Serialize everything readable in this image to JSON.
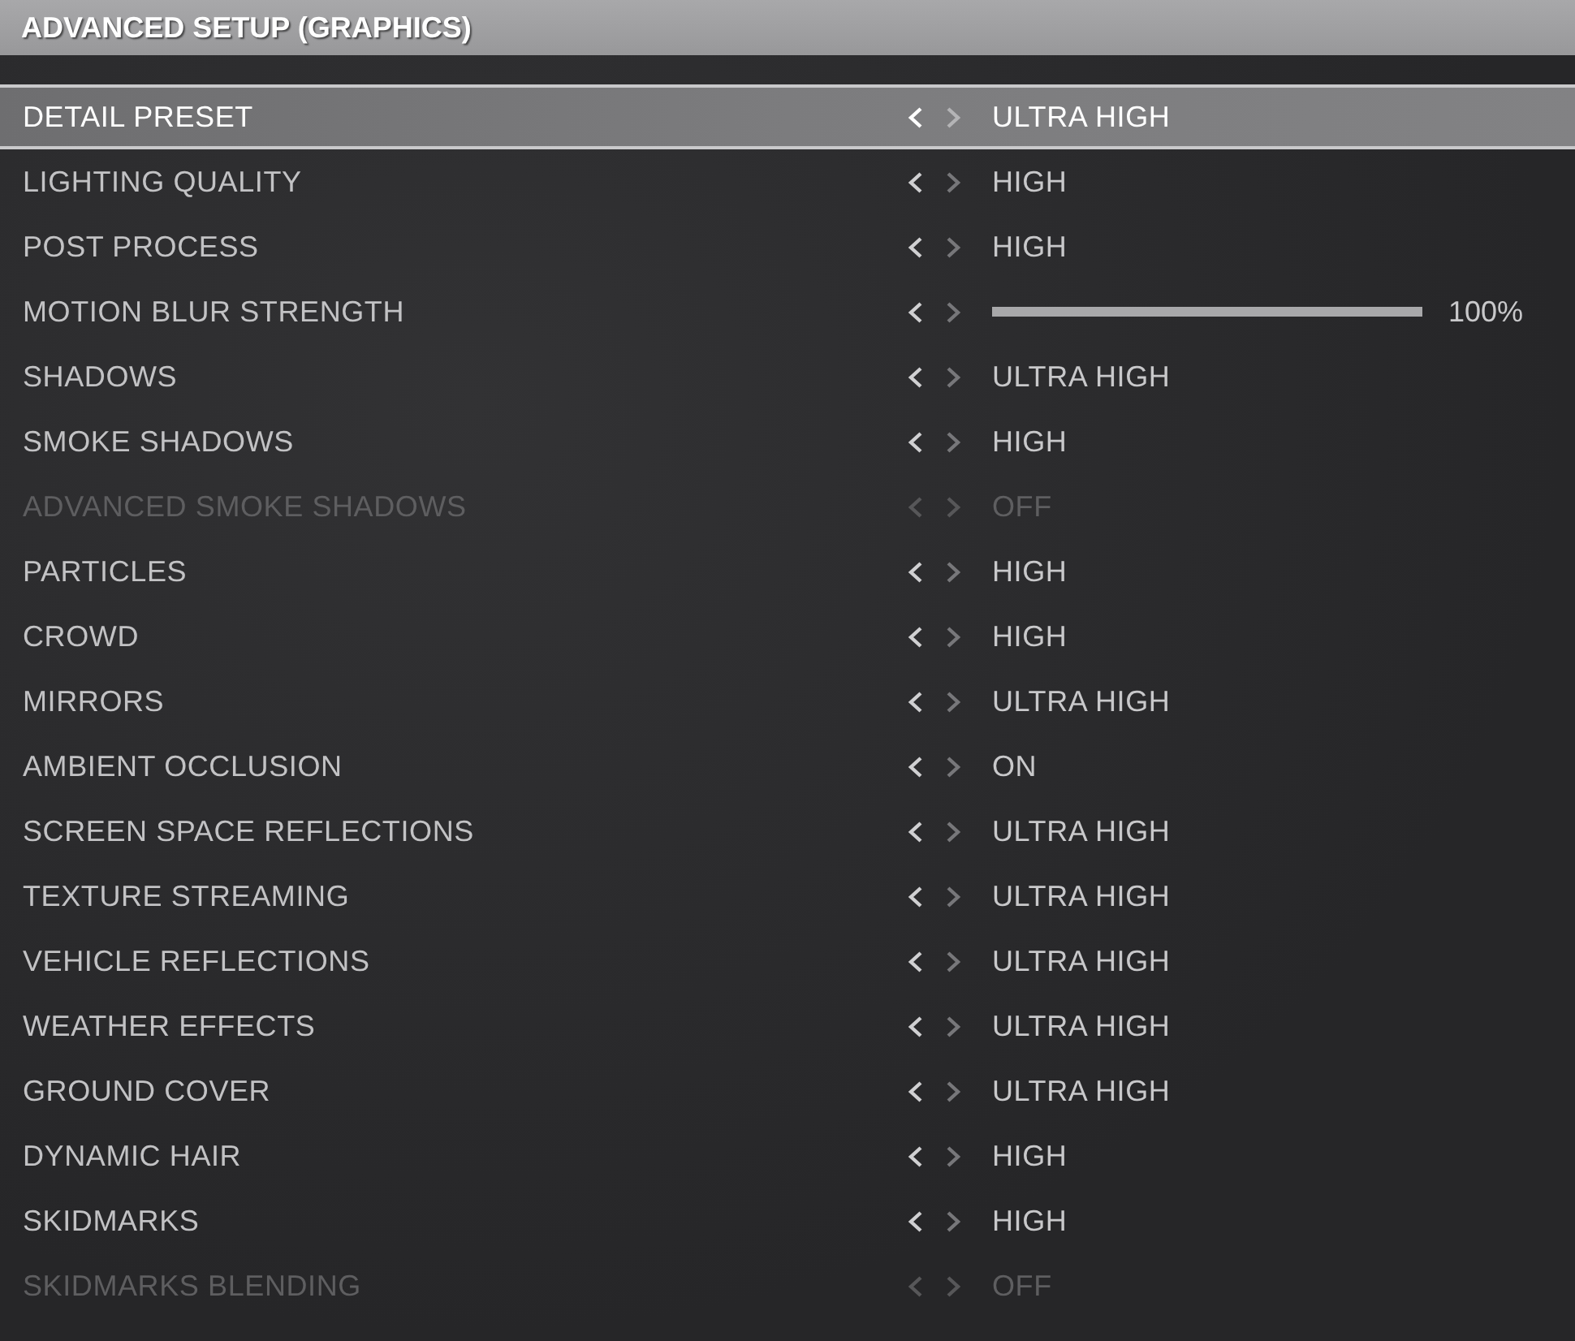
{
  "window": {
    "title": "ADVANCED SETUP (GRAPHICS)"
  },
  "settings": [
    {
      "kind": "option",
      "label": "DETAIL PRESET",
      "value": "ULTRA HIGH",
      "selected": true,
      "disabled": false
    },
    {
      "kind": "option",
      "label": "LIGHTING QUALITY",
      "value": "HIGH",
      "selected": false,
      "disabled": false
    },
    {
      "kind": "option",
      "label": "POST PROCESS",
      "value": "HIGH",
      "selected": false,
      "disabled": false
    },
    {
      "kind": "slider",
      "label": "MOTION BLUR STRENGTH",
      "level": 1,
      "reading": "100%",
      "selected": false,
      "disabled": false
    },
    {
      "kind": "option",
      "label": "SHADOWS",
      "value": "ULTRA HIGH",
      "selected": false,
      "disabled": false
    },
    {
      "kind": "option",
      "label": "SMOKE SHADOWS",
      "value": "HIGH",
      "selected": false,
      "disabled": false
    },
    {
      "kind": "option",
      "label": "ADVANCED SMOKE SHADOWS",
      "value": "OFF",
      "selected": false,
      "disabled": true
    },
    {
      "kind": "option",
      "label": "PARTICLES",
      "value": "HIGH",
      "selected": false,
      "disabled": false
    },
    {
      "kind": "option",
      "label": "CROWD",
      "value": "HIGH",
      "selected": false,
      "disabled": false
    },
    {
      "kind": "option",
      "label": "MIRRORS",
      "value": "ULTRA HIGH",
      "selected": false,
      "disabled": false
    },
    {
      "kind": "option",
      "label": "AMBIENT OCCLUSION",
      "value": "ON",
      "selected": false,
      "disabled": false
    },
    {
      "kind": "option",
      "label": "SCREEN SPACE REFLECTIONS",
      "value": "ULTRA HIGH",
      "selected": false,
      "disabled": false
    },
    {
      "kind": "option",
      "label": "TEXTURE STREAMING",
      "value": "ULTRA HIGH",
      "selected": false,
      "disabled": false
    },
    {
      "kind": "option",
      "label": "VEHICLE REFLECTIONS",
      "value": "ULTRA HIGH",
      "selected": false,
      "disabled": false
    },
    {
      "kind": "option",
      "label": "WEATHER EFFECTS",
      "value": "ULTRA HIGH",
      "selected": false,
      "disabled": false
    },
    {
      "kind": "option",
      "label": "GROUND COVER",
      "value": "ULTRA HIGH",
      "selected": false,
      "disabled": false
    },
    {
      "kind": "option",
      "label": "DYNAMIC HAIR",
      "value": "HIGH",
      "selected": false,
      "disabled": false
    },
    {
      "kind": "option",
      "label": "SKIDMARKS",
      "value": "HIGH",
      "selected": false,
      "disabled": false
    },
    {
      "kind": "option",
      "label": "SKIDMARKS BLENDING",
      "value": "OFF",
      "selected": false,
      "disabled": true
    }
  ]
}
